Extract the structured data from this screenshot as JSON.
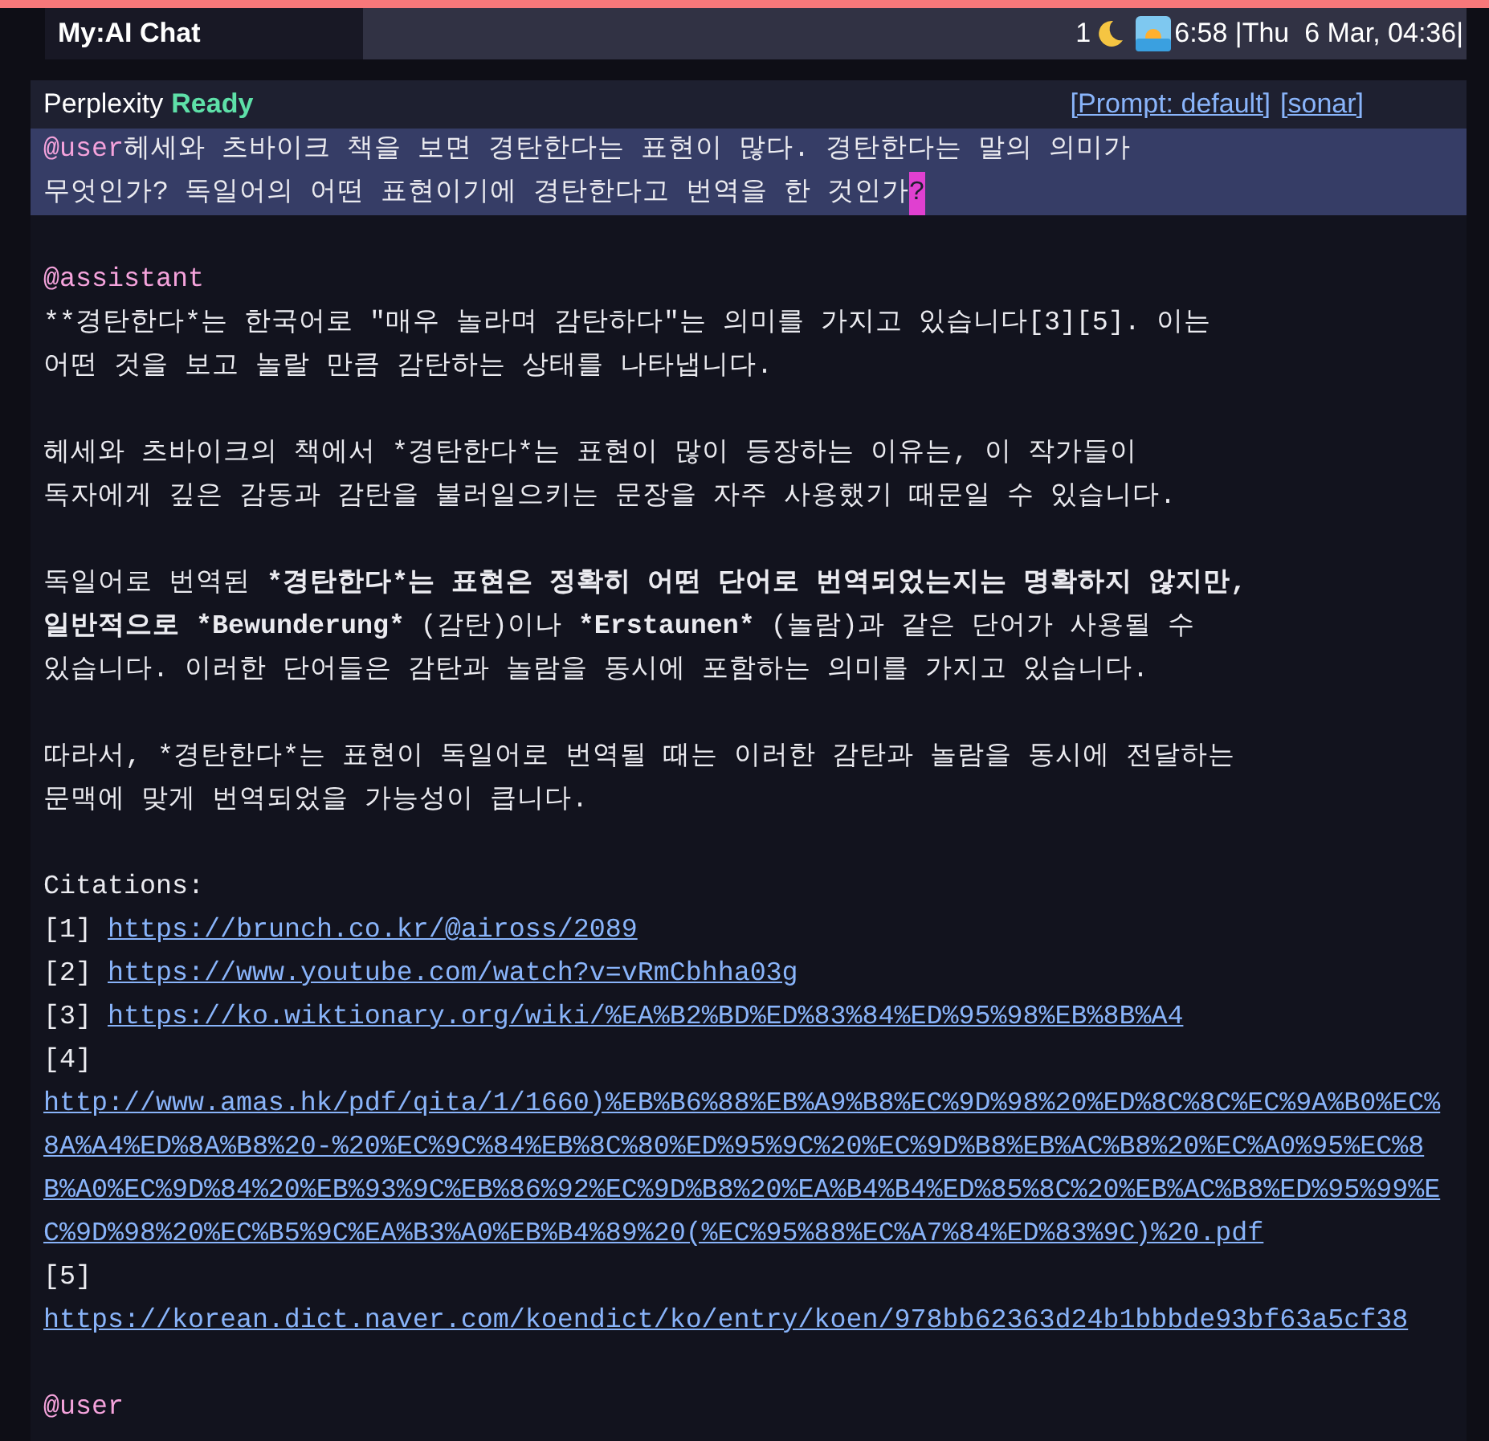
{
  "top_bar": {
    "title": "My:AI Chat",
    "count": "1",
    "clock": "6:58 |Thu  6 Mar, 04:36|"
  },
  "header": {
    "provider": "Perplexity",
    "state": "Ready",
    "links": [
      "[Prompt: default]",
      "[sonar]"
    ]
  },
  "messages": [
    {
      "kind": "user",
      "speaker": "@user",
      "selected": true,
      "lines": [
        "헤세와 츠바이크 책을 보면 경탄한다는 표현이 많다. 경탄한다는 말의 의미가",
        "무엇인가? 독일어의 어떤 표현이기에 경탄한다고 번역을 한 것인가"
      ],
      "cursor": "?"
    },
    {
      "kind": "assistant",
      "speaker": "@assistant",
      "paragraphs": [
        [
          [
            {
              "text": "**경탄한다*는 한국어로 \"매우 놀라며 감탄하다\"는 의미를 가지고 있습니다[3][5]. 이는",
              "bold": false
            }
          ],
          [
            {
              "text": "어떤 것을 보고 놀랄 만큼 감탄하는 상태를 나타냅니다.",
              "bold": false
            }
          ]
        ],
        [
          [
            {
              "text": "헤세와 츠바이크의 책에서 *경탄한다*는 표현이 많이 등장하는 이유는, 이 작가들이",
              "bold": false
            }
          ],
          [
            {
              "text": "독자에게 깊은 감동과 감탄을 불러일으키는 문장을 자주 사용했기 때문일 수 있습니다.",
              "bold": false
            }
          ]
        ],
        [
          [
            {
              "text": "독일어로 번역된 ",
              "bold": false
            },
            {
              "text": "*경탄한다*는 표현은 정확히 어떤 단어로 번역되었는지는 명확하지 않지만,",
              "bold": true
            }
          ],
          [
            {
              "text": "일반적으로 *Bewunderung*",
              "bold": true
            },
            {
              "text": " (감탄)이나 ",
              "bold": false
            },
            {
              "text": "*Erstaunen*",
              "bold": true
            },
            {
              "text": " (놀람)과 같은 단어가 사용될 수",
              "bold": false
            }
          ],
          [
            {
              "text": "있습니다. 이러한 단어들은 감탄과 놀람을 동시에 포함하는 의미를 가지고 있습니다.",
              "bold": false
            }
          ]
        ],
        [
          [
            {
              "text": "따라서, *경탄한다*는 표현이 독일어로 번역될 때는 이러한 감탄과 놀람을 동시에 전달하는",
              "bold": false
            }
          ],
          [
            {
              "text": "문맥에 맞게 번역되었을 가능성이 큽니다.",
              "bold": false
            }
          ]
        ]
      ],
      "citations": {
        "heading": "Citations:",
        "items": [
          {
            "kind": "inline",
            "number": "[1]",
            "url": "https://brunch.co.kr/@aiross/2089"
          },
          {
            "kind": "inline",
            "number": "[2]",
            "url": "https://www.youtube.com/watch?v=vRmCbhha03g"
          },
          {
            "kind": "inline",
            "number": "[3]",
            "url": "https://ko.wiktionary.org/wiki/%EA%B2%BD%ED%83%84%ED%95%98%EB%8B%A4"
          },
          {
            "kind": "block",
            "number": "[4]",
            "url": "http://www.amas.hk/pdf/qita/1/1660)%EB%B6%88%EB%A9%B8%EC%9D%98%20%ED%8C%8C%EC%9A%B0%EC%8A%A4%ED%8A%B8%20-%20%EC%9C%84%EB%8C%80%ED%95%9C%20%EC%9D%B8%EB%AC%B8%20%EC%A0%95%EC%8B%A0%EC%9D%84%20%EB%93%9C%EB%86%92%EC%9D%B8%20%EA%B4%B4%ED%85%8C%20%EB%AC%B8%ED%95%99%EC%9D%98%20%EC%B5%9C%EA%B3%A0%EB%B4%89%20(%EC%95%88%EC%A7%84%ED%83%9C)%20.pdf"
          },
          {
            "kind": "block",
            "number": "[5]",
            "url": "https://korean.dict.naver.com/koendict/ko/entry/koen/978bb62363d24b1bbbde93bf63a5cf38"
          }
        ]
      }
    },
    {
      "kind": "user",
      "speaker": "@user",
      "selected": false
    }
  ]
}
